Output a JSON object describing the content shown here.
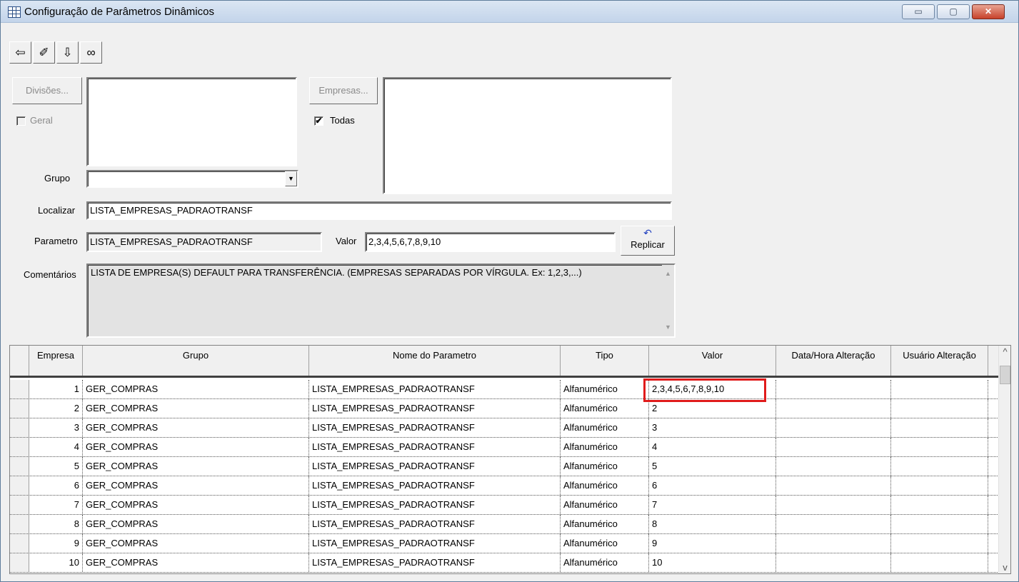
{
  "window": {
    "title": "Configuração de Parâmetros Dinâmicos",
    "controls": {
      "minimize": "▭",
      "maximize": "▢",
      "close": "✕"
    }
  },
  "toolbar": {
    "buttons": [
      {
        "name": "exit-door-icon",
        "glyph": "⇦"
      },
      {
        "name": "eraser-icon",
        "glyph": "✐"
      },
      {
        "name": "save-download-icon",
        "glyph": "⇩"
      },
      {
        "name": "binoculars-icon",
        "glyph": "∞"
      }
    ]
  },
  "filters": {
    "divisoes_button": "Divisões...",
    "geral_label": "Geral",
    "geral_checked": false,
    "empresas_button": "Empresas...",
    "todas_label": "Todas",
    "todas_checked": true,
    "check_glyph": "✔",
    "grupo_label": "Grupo",
    "grupo_value": "",
    "dropdown_glyph": "▼"
  },
  "search": {
    "localizar_label": "Localizar",
    "localizar_value": "LISTA_EMPRESAS_PADRAOTRANSF"
  },
  "detail": {
    "parametro_label": "Parametro",
    "parametro_value": "LISTA_EMPRESAS_PADRAOTRANSF",
    "valor_label": "Valor",
    "valor_value": "2,3,4,5,6,7,8,9,10",
    "replicar_label": "Replicar",
    "replicar_glyph": "↶",
    "comentarios_label": "Comentários",
    "comentarios_value": "LISTA DE EMPRESA(S) DEFAULT PARA TRANSFERÊNCIA. (EMPRESAS SEPARADAS POR VÍRGULA. Ex: 1,2,3,...)",
    "scroll_up": "▲",
    "scroll_down": "▼"
  },
  "grid": {
    "columns": [
      "Empresa",
      "Grupo",
      "Nome do Parametro",
      "Tipo",
      "Valor",
      "Data/Hora Alteração",
      "Usuário Alteração"
    ],
    "rows": [
      {
        "empresa": "1",
        "grupo": "GER_COMPRAS",
        "nome": "LISTA_EMPRESAS_PADRAOTRANSF",
        "tipo": "Alfanumérico",
        "valor": "2,3,4,5,6,7,8,9,10",
        "data": "",
        "usuario": ""
      },
      {
        "empresa": "2",
        "grupo": "GER_COMPRAS",
        "nome": "LISTA_EMPRESAS_PADRAOTRANSF",
        "tipo": "Alfanumérico",
        "valor": "2",
        "data": "",
        "usuario": ""
      },
      {
        "empresa": "3",
        "grupo": "GER_COMPRAS",
        "nome": "LISTA_EMPRESAS_PADRAOTRANSF",
        "tipo": "Alfanumérico",
        "valor": "3",
        "data": "",
        "usuario": ""
      },
      {
        "empresa": "4",
        "grupo": "GER_COMPRAS",
        "nome": "LISTA_EMPRESAS_PADRAOTRANSF",
        "tipo": "Alfanumérico",
        "valor": "4",
        "data": "",
        "usuario": ""
      },
      {
        "empresa": "5",
        "grupo": "GER_COMPRAS",
        "nome": "LISTA_EMPRESAS_PADRAOTRANSF",
        "tipo": "Alfanumérico",
        "valor": "5",
        "data": "",
        "usuario": ""
      },
      {
        "empresa": "6",
        "grupo": "GER_COMPRAS",
        "nome": "LISTA_EMPRESAS_PADRAOTRANSF",
        "tipo": "Alfanumérico",
        "valor": "6",
        "data": "",
        "usuario": ""
      },
      {
        "empresa": "7",
        "grupo": "GER_COMPRAS",
        "nome": "LISTA_EMPRESAS_PADRAOTRANSF",
        "tipo": "Alfanumérico",
        "valor": "7",
        "data": "",
        "usuario": ""
      },
      {
        "empresa": "8",
        "grupo": "GER_COMPRAS",
        "nome": "LISTA_EMPRESAS_PADRAOTRANSF",
        "tipo": "Alfanumérico",
        "valor": "8",
        "data": "",
        "usuario": ""
      },
      {
        "empresa": "9",
        "grupo": "GER_COMPRAS",
        "nome": "LISTA_EMPRESAS_PADRAOTRANSF",
        "tipo": "Alfanumérico",
        "valor": "9",
        "data": "",
        "usuario": ""
      },
      {
        "empresa": "10",
        "grupo": "GER_COMPRAS",
        "nome": "LISTA_EMPRESAS_PADRAOTRANSF",
        "tipo": "Alfanumérico",
        "valor": "10",
        "data": "",
        "usuario": ""
      }
    ],
    "highlight_color": "#e01b1b",
    "scroll_up": "^",
    "scroll_down": "v"
  }
}
